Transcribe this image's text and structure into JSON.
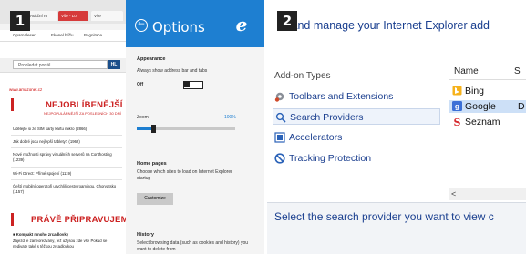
{
  "panel1": {
    "badge": "1",
    "browser": {
      "tabs": [
        "Aukční ro",
        "Vše - Lo",
        "Vše"
      ],
      "bookmarks": [
        "Oparnaleser",
        "Ekonel hlížu",
        "Bagnitace"
      ],
      "search_placeholder": "Prohledat portál",
      "search_button": "HL",
      "site_url": "www.amazonet.cz",
      "section1": {
        "title": "NEJOBLÍBENĚJŠÍ",
        "subtitle": "NEJPOPULÁRNĚJŠÍ ZA POSLEDNÍCH 30 DNÍ",
        "links": [
          "Udělejte si ze SIM karty kartu mikro (2866)",
          "Jak dobré jsou nejlepší tablety? (1962)",
          "Nové možnosti správy virtuálních serverů na Conthosting (1239)",
          "Wi-Fi Direct: Přímé spojení (1119)",
          "Čeští mobilní operátoři urychlili cesty roamingu. Chorvatsko (1157)"
        ]
      },
      "section2": {
        "title": "PRÁVĚ PŘIPRAVUJEME",
        "links": [
          "■ Kompakt mnoho zrcadlovky",
          "Zájezd je zaneorezvaný, tež už jsou zde vše Pokud se nedivate také s těžkou zrcadlovkou"
        ]
      }
    },
    "options": {
      "title": "Options",
      "appearance": {
        "heading": "Appearance",
        "description": "Always show address bar and tabs",
        "toggle_state": "Off"
      },
      "zoom": {
        "label": "Zoom",
        "value": "100%",
        "fraction": 0.17
      },
      "home_pages": {
        "heading": "Home pages",
        "description": "Choose which sites to load on Internet Explorer startup",
        "button": "Customize"
      },
      "history": {
        "heading": "History",
        "description": "Select browsing data (such as cookies and history) you want to delete from"
      }
    }
  },
  "panel2": {
    "badge": "2",
    "title": "w and manage your Internet Explorer add",
    "addon_types_heading": "Add-on Types",
    "addon_types": [
      {
        "label": "Toolbars and Extensions",
        "icon": "gear-icon"
      },
      {
        "label": "Search Providers",
        "icon": "magnifier-icon"
      },
      {
        "label": "Accelerators",
        "icon": "accelerator-icon"
      },
      {
        "label": "Tracking Protection",
        "icon": "no-entry-icon"
      }
    ],
    "list_columns": [
      "Name",
      "S"
    ],
    "providers": [
      {
        "name": "Bing",
        "status": "",
        "icon": "bing-icon"
      },
      {
        "name": "Google",
        "status": "D",
        "icon": "google-icon"
      },
      {
        "name": "Seznam",
        "status": "",
        "icon": "seznam-icon"
      }
    ],
    "scroll_arrow": "<",
    "description": "Select the search provider you want to view c"
  }
}
